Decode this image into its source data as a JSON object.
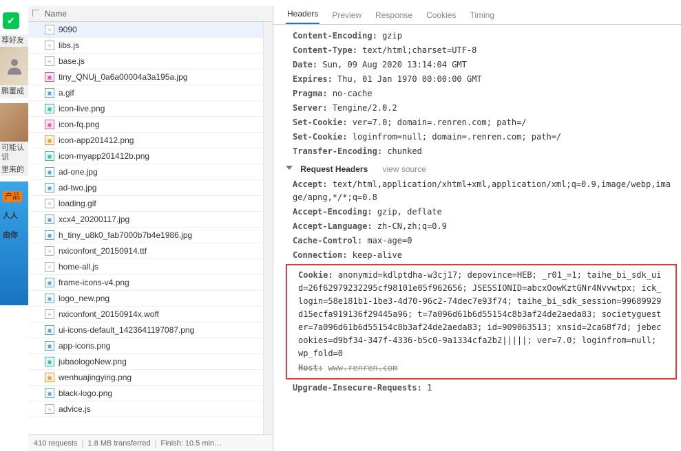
{
  "left_rail": {
    "ad1_text": "荐好友",
    "ad1_name": "鹏董成",
    "ad2_label": "可能认识",
    "ad2_from": "里来的",
    "ad3_tag": "产品",
    "ad3_line1": "人人",
    "ad3_line2": "由你"
  },
  "files": {
    "header": "Name",
    "items": [
      {
        "name": "9090",
        "icon": "doc",
        "sel": true
      },
      {
        "name": "libs.js",
        "icon": "doc"
      },
      {
        "name": "base.js",
        "icon": "doc"
      },
      {
        "name": "tiny_QNUj_0a6a00004a3a195a.jpg",
        "icon": "img-pink"
      },
      {
        "name": "a.gif",
        "icon": "img"
      },
      {
        "name": "icon-live.png",
        "icon": "img-teal"
      },
      {
        "name": "icon-fq.png",
        "icon": "img-pink"
      },
      {
        "name": "icon-app201412.png",
        "icon": "img-orange"
      },
      {
        "name": "icon-myapp201412b.png",
        "icon": "img-teal"
      },
      {
        "name": "ad-one.jpg",
        "icon": "img"
      },
      {
        "name": "ad-two.jpg",
        "icon": "img"
      },
      {
        "name": "loading.gif",
        "icon": "doc"
      },
      {
        "name": "xcx4_20200117.jpg",
        "icon": "img"
      },
      {
        "name": "h_tiny_u8k0_fab7000b7b4e1986.jpg",
        "icon": "img"
      },
      {
        "name": "nxiconfont_20150914.ttf",
        "icon": "doc",
        "sel2": true
      },
      {
        "name": "home-all.js",
        "icon": "doc"
      },
      {
        "name": "frame-icons-v4.png",
        "icon": "img"
      },
      {
        "name": "logo_new.png",
        "icon": "img"
      },
      {
        "name": "nxiconfont_20150914x.woff",
        "icon": "doc"
      },
      {
        "name": "ui-icons-default_1423641197087.png",
        "icon": "img"
      },
      {
        "name": "app-icons.png",
        "icon": "img"
      },
      {
        "name": "jubaologoNew.png",
        "icon": "img-teal"
      },
      {
        "name": "wenhuajingying.png",
        "icon": "img-orange"
      },
      {
        "name": "black-logo.png",
        "icon": "img"
      },
      {
        "name": "advice.js",
        "icon": "doc"
      }
    ],
    "footer": {
      "requests": "410 requests",
      "transfer": "1.8 MB transferred",
      "finish": "Finish: 10.5 min…"
    }
  },
  "detail": {
    "tabs": [
      "Headers",
      "Preview",
      "Response",
      "Cookies",
      "Timing"
    ],
    "active_tab": 0,
    "response_headers": [
      {
        "k": "Content-Encoding:",
        "v": "gzip"
      },
      {
        "k": "Content-Type:",
        "v": "text/html;charset=UTF-8"
      },
      {
        "k": "Date:",
        "v": "Sun, 09 Aug 2020 13:14:04 GMT"
      },
      {
        "k": "Expires:",
        "v": "Thu, 01 Jan 1970 00:00:00 GMT"
      },
      {
        "k": "Pragma:",
        "v": "no-cache"
      },
      {
        "k": "Server:",
        "v": "Tengine/2.0.2"
      },
      {
        "k": "Set-Cookie:",
        "v": "ver=7.0; domain=.renren.com; path=/"
      },
      {
        "k": "Set-Cookie:",
        "v": "loginfrom=null; domain=.renren.com; path=/"
      },
      {
        "k": "Transfer-Encoding:",
        "v": "chunked"
      }
    ],
    "req_section": "Request Headers",
    "view_source": "view source",
    "request_headers_pre": [
      {
        "k": "Accept:",
        "v": "text/html,application/xhtml+xml,application/xml;q=0.9,image/webp,image/apng,*/*;q=0.8"
      },
      {
        "k": "Accept-Encoding:",
        "v": "gzip, deflate"
      },
      {
        "k": "Accept-Language:",
        "v": "zh-CN,zh;q=0.9"
      },
      {
        "k": "Cache-Control:",
        "v": "max-age=0"
      },
      {
        "k": "Connection:",
        "v": "keep-alive"
      }
    ],
    "cookie_k": "Cookie:",
    "cookie_v": "anonymid=kdlptdha-w3cj17; depovince=HEB; _r01_=1; taihe_bi_sdk_uid=26f62979232295cf98101e05f962656; JSESSIONID=abcxOowKztGNr4Nvvwtpx; ick_login=58e181b1-1be3-4d70-96c2-74dec7e93f74; taihe_bi_sdk_session=99689929d15ecfa919136f29445a96; t=7a096d61b6d55154c8b3af24de2aeda83; societyguester=7a096d61b6d55154c8b3af24de2aeda83; id=909063513; xnsid=2ca68f7d; jebecookies=d9bf34-347f-4336-b5c0-9a1334cfa2b2|||||; ver=7.0; loginfrom=null; wp_fold=0",
    "host_k": "Host:",
    "host_v": "www.renren.com",
    "request_headers_post": [
      {
        "k": "Upgrade-Insecure-Requests:",
        "v": "1"
      }
    ]
  }
}
